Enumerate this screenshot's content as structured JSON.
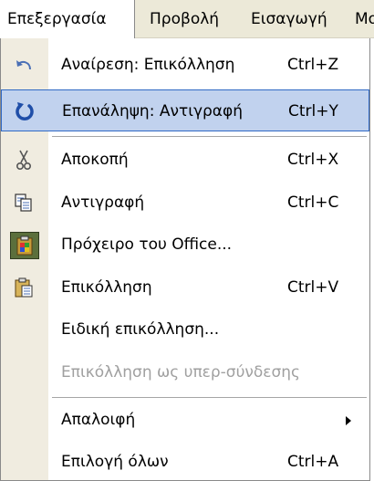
{
  "menubar": {
    "items": [
      {
        "label": "Επεξεργασία",
        "active": true
      },
      {
        "label": "Προβολή"
      },
      {
        "label": "Εισαγωγή"
      },
      {
        "label": "Μο"
      }
    ]
  },
  "menu": {
    "items": [
      {
        "label": "Αναίρεση: Επικόλληση",
        "shortcut": "Ctrl+Z",
        "icon": "undo-icon"
      },
      {
        "label": "Επανάληψη: Αντιγραφή",
        "shortcut": "Ctrl+Y",
        "icon": "redo-icon",
        "highlighted": true
      },
      {
        "label": "Αποκοπή",
        "shortcut": "Ctrl+X",
        "icon": "scissors-icon"
      },
      {
        "label": "Αντιγραφή",
        "shortcut": "Ctrl+C",
        "icon": "copy-icon"
      },
      {
        "label": "Πρόχειρο του Office...",
        "shortcut": "",
        "icon": "office-clipboard-icon"
      },
      {
        "label": "Επικόλληση",
        "shortcut": "Ctrl+V",
        "icon": "paste-icon"
      },
      {
        "label": "Ειδική επικόλληση...",
        "shortcut": ""
      },
      {
        "label": "Επικόλληση ως υπερ-σύνδεσης",
        "shortcut": "",
        "disabled": true
      },
      {
        "label": "Απαλοιφή",
        "shortcut": "",
        "submenu": true
      },
      {
        "label": "Επιλογή όλων",
        "shortcut": "Ctrl+A"
      }
    ]
  },
  "colors": {
    "highlight_bg": "#c1d2ee",
    "highlight_border": "#316ac5",
    "gutter": "#f0ece0",
    "menubar": "#ece9d8",
    "disabled_text": "#a0a0a0"
  }
}
